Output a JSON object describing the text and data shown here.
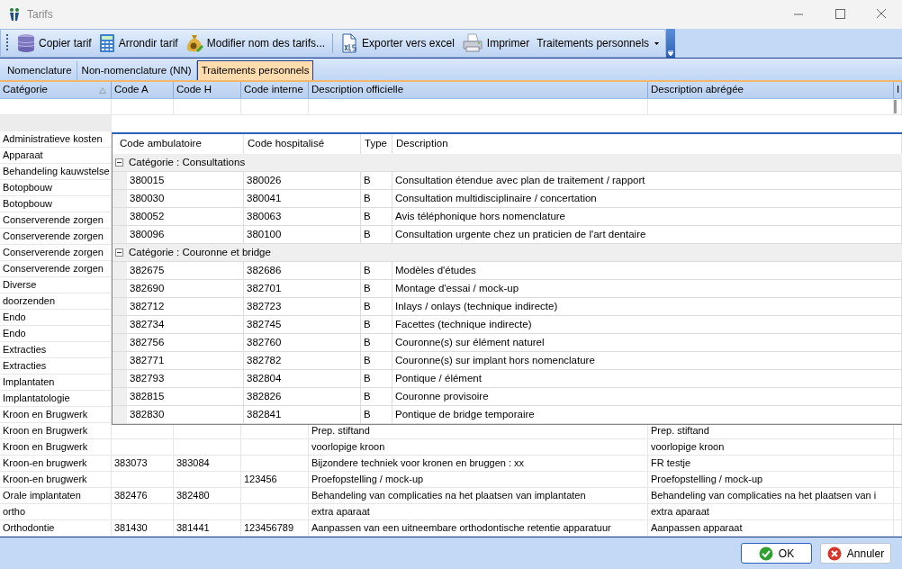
{
  "window": {
    "title": "Tarifs"
  },
  "toolbar": {
    "items": [
      {
        "label": "Copier tarif",
        "kind": "copy",
        "separator_before": false
      },
      {
        "label": "Arrondir tarif",
        "kind": "round",
        "separator_before": false
      },
      {
        "label": "Modifier nom des tarifs...",
        "kind": "rename",
        "separator_before": false
      },
      {
        "label": "Exporter vers excel",
        "kind": "export",
        "separator_before": true
      },
      {
        "label": "Imprimer",
        "kind": "print",
        "separator_before": false
      },
      {
        "label": "Traitements personnels",
        "kind": "dropdown",
        "separator_before": false
      }
    ]
  },
  "tabs": [
    {
      "label": "Nomenclature",
      "selected": false
    },
    {
      "label": "Non-nomenclature (NN)",
      "selected": false
    },
    {
      "label": "Traitements personnels",
      "selected": true
    }
  ],
  "table": {
    "columns": [
      {
        "label": "Catégorie",
        "sorted": true
      },
      {
        "label": "Code A",
        "sorted": false
      },
      {
        "label": "Code H",
        "sorted": false
      },
      {
        "label": "Code interne",
        "sorted": false
      },
      {
        "label": "Description officielle",
        "sorted": false
      },
      {
        "label": "Description abrégée",
        "sorted": false
      },
      {
        "label": "I",
        "sorted": false
      }
    ],
    "rows": [
      [
        "Administratieve kosten"
      ],
      [
        "Apparaat"
      ],
      [
        "Behandeling kauwstelse"
      ],
      [
        "Botopbouw"
      ],
      [
        "Botopbouw"
      ],
      [
        "Conserverende zorgen"
      ],
      [
        "Conserverende zorgen"
      ],
      [
        "Conserverende zorgen"
      ],
      [
        "Conserverende zorgen"
      ],
      [
        "Diverse"
      ],
      [
        "doorzenden"
      ],
      [
        "Endo"
      ],
      [
        "Endo"
      ],
      [
        "Extracties"
      ],
      [
        "Extracties"
      ],
      [
        "Implantaten"
      ],
      [
        "Implantatologie"
      ],
      [
        "Kroon en Brugwerk"
      ],
      [
        "Kroon en Brugwerk",
        "",
        "",
        "",
        "Prep. stiftand",
        "Prep. stiftand"
      ],
      [
        "Kroon en Brugwerk",
        "",
        "",
        "",
        "voorlopige kroon",
        "voorlopige kroon"
      ],
      [
        "Kroon-en brugwerk",
        "383073",
        "383084",
        "",
        "Bijzondere techniek voor kronen en bruggen : xx",
        "FR testje"
      ],
      [
        "Kroon-en brugwerk",
        "",
        "",
        "123456",
        "Proefopstelling / mock-up",
        "Proefopstelling / mock-up"
      ],
      [
        "Orale implantaten",
        "382476",
        "382480",
        "",
        "Behandeling van complicaties na het plaatsen van implantaten",
        "Behandeling van complicaties na het plaatsen van i"
      ],
      [
        "ortho",
        "",
        "",
        "",
        "extra aparaat",
        "extra aparaat"
      ],
      [
        "Orthodontie",
        "381430",
        "381441",
        "123456789",
        "Aanpassen van een uitneembare orthodontische retentie apparatuur",
        "Aanpassen apparaat"
      ]
    ]
  },
  "dropdown": {
    "columns": [
      "Code ambulatoire",
      "Code hospitalisé",
      "Type",
      "Description"
    ],
    "groups": [
      {
        "label": "Catégorie : Consultations",
        "expanded": true,
        "rows": [
          [
            "380015",
            "380026",
            "B",
            "Consultation étendue avec plan de traitement / rapport"
          ],
          [
            "380030",
            "380041",
            "B",
            "Consultation multidisciplinaire / concertation"
          ],
          [
            "380052",
            "380063",
            "B",
            "Avis téléphonique hors nomenclature"
          ],
          [
            "380096",
            "380100",
            "B",
            "Consultation urgente chez un praticien de l'art dentaire"
          ]
        ]
      },
      {
        "label": "Catégorie : Couronne et bridge",
        "expanded": true,
        "rows": [
          [
            "382675",
            "382686",
            "B",
            "Modèles d'études"
          ],
          [
            "382690",
            "382701",
            "B",
            "Montage d'essai / mock-up"
          ],
          [
            "382712",
            "382723",
            "B",
            "Inlays / onlays (technique indirecte)"
          ],
          [
            "382734",
            "382745",
            "B",
            "Facettes (technique indirecte)"
          ],
          [
            "382756",
            "382760",
            "B",
            "Couronne(s) sur élément naturel"
          ],
          [
            "382771",
            "382782",
            "B",
            "Couronne(s) sur implant hors nomenclature"
          ],
          [
            "382793",
            "382804",
            "B",
            "Pontique / élément"
          ],
          [
            "382815",
            "382826",
            "B",
            "Couronne provisoire"
          ],
          [
            "382830",
            "382841",
            "B",
            "Pontique de bridge temporaire"
          ]
        ]
      }
    ]
  },
  "buttons": [
    {
      "label": "OK",
      "kind": "ok"
    },
    {
      "label": "Annuler",
      "kind": "cancel"
    }
  ]
}
